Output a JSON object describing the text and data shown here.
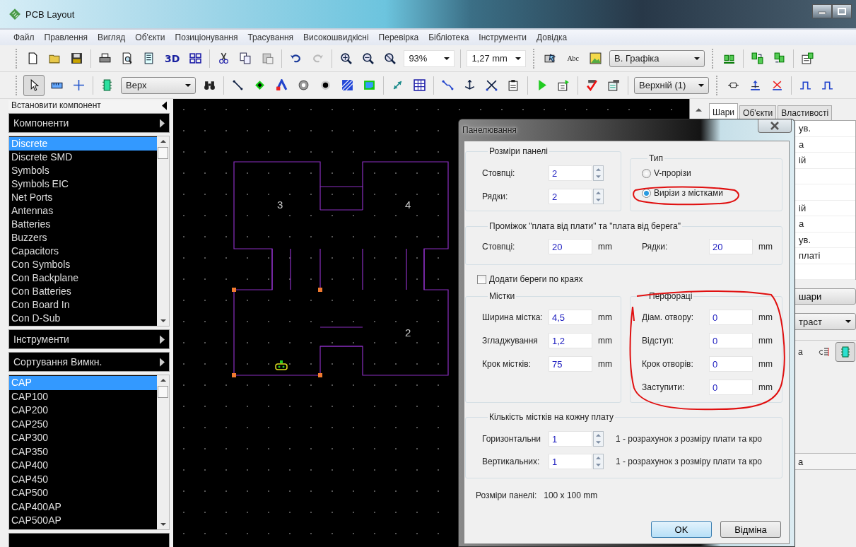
{
  "window": {
    "title": "PCB Layout"
  },
  "menu": [
    "Файл",
    "Правлення",
    "Вигляд",
    "Об'єкти",
    "Позиціонування",
    "Трасування",
    "Високошвидкісні",
    "Перевірка",
    "Бібліотека",
    "Інструменти",
    "Довідка"
  ],
  "toolbar_1": {
    "view_3d": "3D",
    "zoom": "93%",
    "grid_step": "1,27 mm",
    "text_tool": "Abc",
    "graphics_layer": "В. Графіка"
  },
  "toolbar_2": {
    "select_tool": {
      "selected": true
    },
    "layer": "Верх",
    "net_layer": "Верхній (1)"
  },
  "left_panel": {
    "title": "Встановити компонент",
    "sections": [
      {
        "kind": "header",
        "label": "Компоненти"
      },
      {
        "kind": "list",
        "items": [
          {
            "label": "Discrete",
            "selected": true
          },
          {
            "label": "Discrete SMD",
            "selected": false
          },
          {
            "label": "Symbols",
            "selected": false
          },
          {
            "label": "Symbols EIC",
            "selected": false
          },
          {
            "label": "Net Ports",
            "selected": false
          },
          {
            "label": "Antennas",
            "selected": false
          },
          {
            "label": "Batteries",
            "selected": false
          },
          {
            "label": "Buzzers",
            "selected": false
          },
          {
            "label": "Capacitors",
            "selected": false
          },
          {
            "label": "Con Symbols",
            "selected": false
          },
          {
            "label": "Con Backplane",
            "selected": false
          },
          {
            "label": "Con Batteries",
            "selected": false
          },
          {
            "label": "Con Board In",
            "selected": false
          },
          {
            "label": "Con D-Sub",
            "selected": false
          }
        ]
      },
      {
        "kind": "header",
        "label": "Інструменти"
      },
      {
        "kind": "header",
        "label": "Сортування Вимкн."
      },
      {
        "kind": "list",
        "items": [
          {
            "label": "CAP",
            "selected": true
          },
          {
            "label": "CAP100",
            "selected": false
          },
          {
            "label": "CAP200",
            "selected": false
          },
          {
            "label": "CAP250",
            "selected": false
          },
          {
            "label": "CAP300",
            "selected": false
          },
          {
            "label": "CAP350",
            "selected": false
          },
          {
            "label": "CAP400",
            "selected": false
          },
          {
            "label": "CAP450",
            "selected": false
          },
          {
            "label": "CAP500",
            "selected": false
          },
          {
            "label": "CAP400AP",
            "selected": false
          },
          {
            "label": "CAP500AP",
            "selected": false
          }
        ]
      },
      {
        "kind": "header"
      }
    ]
  },
  "canvas": {
    "board_labels": [
      "3",
      "4",
      "2"
    ]
  },
  "right_panel": {
    "tabs": [
      {
        "label": "Шари",
        "selected": true
      },
      {
        "label": "Об'єкти",
        "selected": false
      },
      {
        "label": "Властивості",
        "selected": false
      }
    ],
    "rows": [
      {
        "text": "ув."
      },
      {
        "text": "а"
      },
      {
        "text": "ій"
      },
      {},
      {},
      {
        "text": "ій"
      },
      {
        "text": "а"
      },
      {
        "text": "ув."
      },
      {
        "text": "платі"
      },
      {}
    ],
    "layers_button": "шари",
    "contrast_dropdown": "траст",
    "toolbar_label": "а",
    "footer_label": "а"
  },
  "dialog": {
    "title": "Панелювання",
    "panel_size": {
      "title": "Розміри панелі",
      "fields": [
        {
          "label": "Стовпці:",
          "value": "2"
        },
        {
          "label": "Рядки:",
          "value": "2"
        }
      ]
    },
    "type": {
      "title": "Тип",
      "options": [
        {
          "label": "V-прорізи",
          "selected": false
        },
        {
          "label": "Вирізи з містками",
          "selected": true
        }
      ]
    },
    "spacing": {
      "title": "Проміжок \"плата від плати\" та \"плата від берега\"",
      "fields": [
        {
          "label": "Стовпці:",
          "value": "20",
          "unit": "mm"
        },
        {
          "label": "Рядки:",
          "value": "20",
          "unit": "mm"
        }
      ]
    },
    "add_rails": {
      "label": "Додати береги по краях",
      "checked": false
    },
    "bridges": {
      "title": "Містки",
      "fields": [
        {
          "label": "Ширина містка:",
          "value": "4,5",
          "unit": "mm"
        },
        {
          "label": "Згладжування",
          "value": "1,2",
          "unit": "mm"
        },
        {
          "label": "Крок містків:",
          "value": "75",
          "unit": "mm"
        }
      ]
    },
    "perforations": {
      "title": "Перфораці",
      "fields": [
        {
          "label": "Діам. отвору:",
          "value": "0",
          "unit": "mm"
        },
        {
          "label": "Відступ:",
          "value": "0",
          "unit": "mm"
        },
        {
          "label": "Крок отворів:",
          "value": "0",
          "unit": "mm"
        },
        {
          "label": "Заступити:",
          "value": "0",
          "unit": "mm"
        }
      ]
    },
    "bridge_count": {
      "title": "Кількість містків на кожну плату",
      "fields": [
        {
          "label": "Горизонтальни",
          "value": "1",
          "note": "1 - розрахунок з розміру плати та кро"
        },
        {
          "label": "Вертикальних:",
          "value": "1",
          "note": "1 - розрахунок з розміру плати та кро"
        }
      ]
    },
    "summary": {
      "label": "Розміри панелі:",
      "value": "100 x 100 mm"
    },
    "buttons": [
      {
        "label": "OK",
        "default": true
      },
      {
        "label": "Відміна",
        "default": false
      }
    ]
  }
}
